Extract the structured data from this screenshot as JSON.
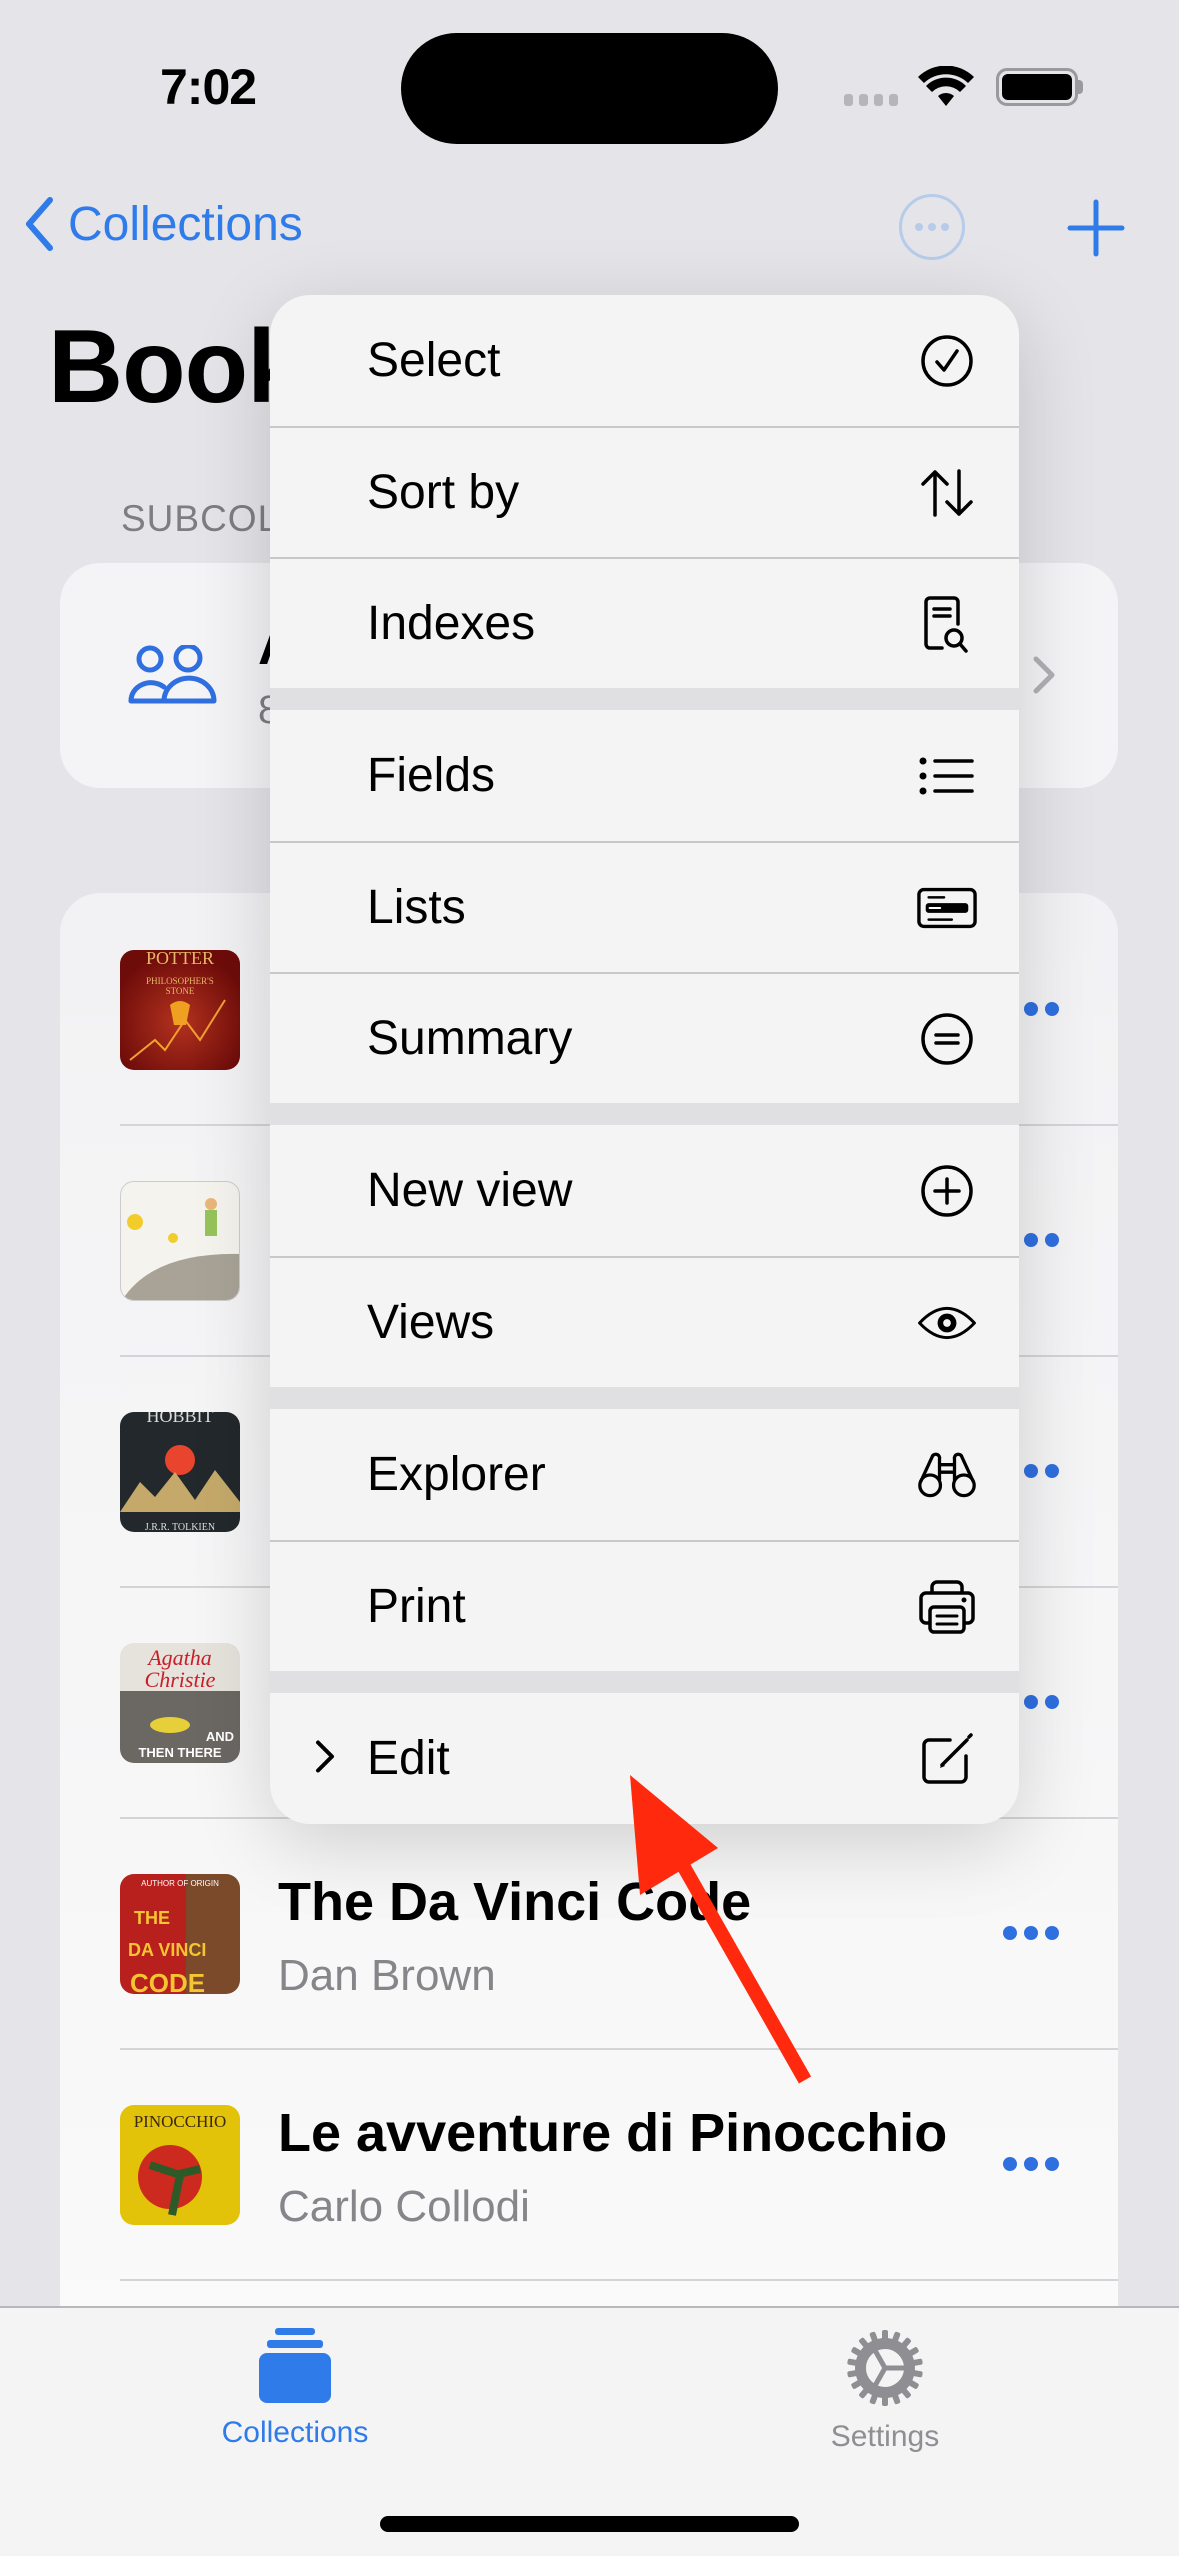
{
  "status_bar": {
    "time": "7:02"
  },
  "nav": {
    "back_label": "Collections",
    "accent_color": "#2F7BEA"
  },
  "page": {
    "large_title_visible": "Book",
    "section_header_visible": "SUBCOL",
    "subcollection": {
      "title_visible": "A",
      "count_visible": "8"
    }
  },
  "books": [
    {
      "title": "",
      "author": "",
      "cover": "harry-potter-philosophers-stone"
    },
    {
      "title": "",
      "author": "",
      "cover": "le-petit-prince"
    },
    {
      "title": "",
      "author": "",
      "cover": "the-hobbit"
    },
    {
      "title": "",
      "author": "",
      "cover": "and-then-there-were-none"
    },
    {
      "title": "The Da Vinci Code",
      "author": "Dan Brown",
      "cover": "the-da-vinci-code"
    },
    {
      "title": "Le avventure di Pinocchio",
      "author": "Carlo Collodi",
      "cover": "pinocchio"
    }
  ],
  "menu": {
    "groups": [
      [
        {
          "label": "Select",
          "icon": "checkmark-circle-icon"
        },
        {
          "label": "Sort by",
          "icon": "sort-arrows-icon"
        },
        {
          "label": "Indexes",
          "icon": "document-search-icon"
        }
      ],
      [
        {
          "label": "Fields",
          "icon": "list-bullet-icon"
        },
        {
          "label": "Lists",
          "icon": "list-card-icon"
        },
        {
          "label": "Summary",
          "icon": "equal-circle-icon"
        }
      ],
      [
        {
          "label": "New view",
          "icon": "plus-circle-icon"
        },
        {
          "label": "Views",
          "icon": "eye-icon"
        }
      ],
      [
        {
          "label": "Explorer",
          "icon": "binoculars-icon"
        },
        {
          "label": "Print",
          "icon": "printer-icon"
        }
      ],
      [
        {
          "label": "Edit",
          "icon": "square-pencil-icon",
          "submenu": true
        }
      ]
    ]
  },
  "tabbar": {
    "tabs": [
      {
        "label": "Collections",
        "icon": "collections-stack-icon",
        "active": true
      },
      {
        "label": "Settings",
        "icon": "gear-icon",
        "active": false
      }
    ]
  },
  "annotation": {
    "type": "arrow",
    "color": "#FF2A0E",
    "points_to": "Edit"
  }
}
